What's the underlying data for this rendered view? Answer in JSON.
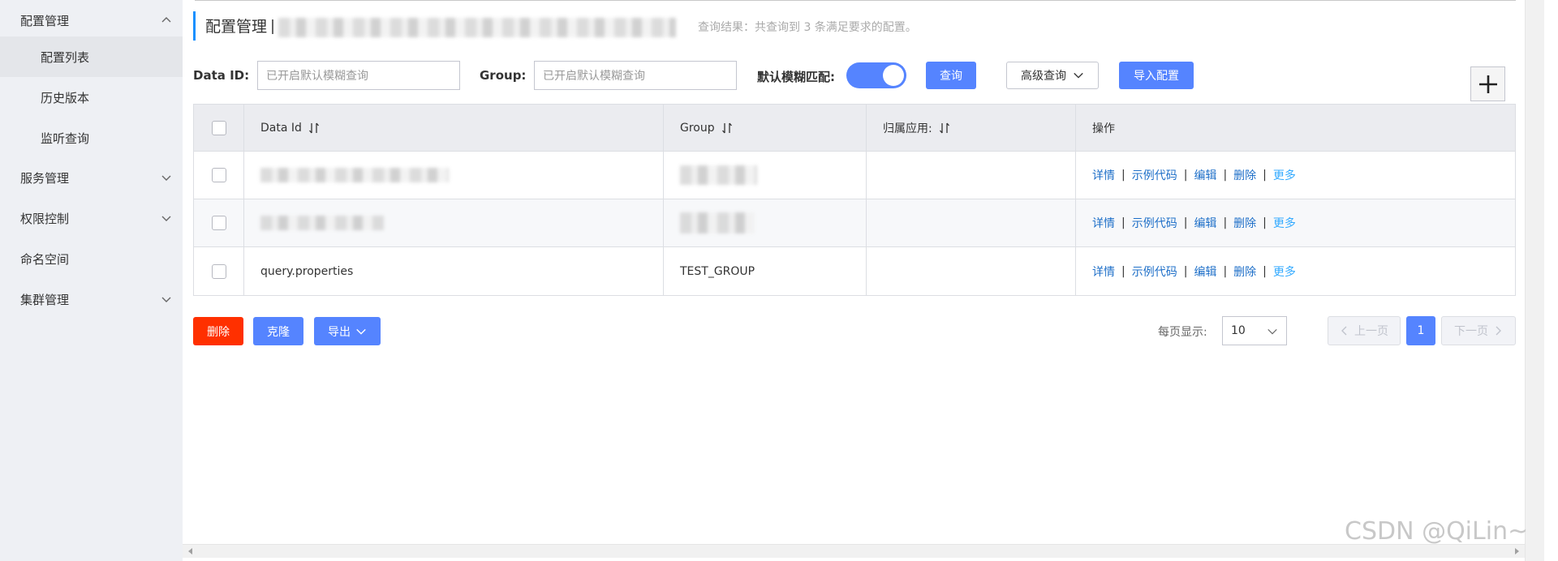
{
  "sidebar": {
    "items": [
      {
        "label": "配置管理",
        "expanded": true
      },
      {
        "label": "配置列表",
        "active": true
      },
      {
        "label": "历史版本"
      },
      {
        "label": "监听查询"
      },
      {
        "label": "服务管理"
      },
      {
        "label": "权限控制"
      },
      {
        "label": "命名空间"
      },
      {
        "label": "集群管理"
      }
    ]
  },
  "header": {
    "title": "配置管理",
    "result_text": "查询结果：共查询到 3 条满足要求的配置。"
  },
  "search": {
    "data_id_label": "Data ID:",
    "data_id_placeholder": "已开启默认模糊查询",
    "group_label": "Group:",
    "group_placeholder": "已开启默认模糊查询",
    "fuzzy_label": "默认模糊匹配:",
    "fuzzy_enabled": true,
    "query_button": "查询",
    "advanced_button": "高级查询",
    "import_button": "导入配置"
  },
  "table": {
    "columns": [
      "Data Id",
      "Group",
      "归属应用:",
      "操作"
    ],
    "rows": [
      {
        "data_id": "",
        "group": "",
        "app": "",
        "blurred": true
      },
      {
        "data_id": "",
        "group": "",
        "app": "",
        "blurred": true
      },
      {
        "data_id": "query.properties",
        "group": "TEST_GROUP",
        "app": "",
        "blurred": false
      }
    ],
    "actions": [
      "详情",
      "示例代码",
      "编辑",
      "删除",
      "更多"
    ]
  },
  "footer": {
    "delete_button": "删除",
    "clone_button": "克隆",
    "export_button": "导出",
    "per_page_label": "每页显示:",
    "per_page_value": "10",
    "prev_button": "上一页",
    "current_page": "1",
    "next_button": "下一页"
  },
  "watermark": "CSDN @QiLin~",
  "colors": {
    "primary": "#5584ff",
    "danger": "#ff3000",
    "link": "#1e6fc8",
    "sidebar_bg": "#eef0f4"
  }
}
